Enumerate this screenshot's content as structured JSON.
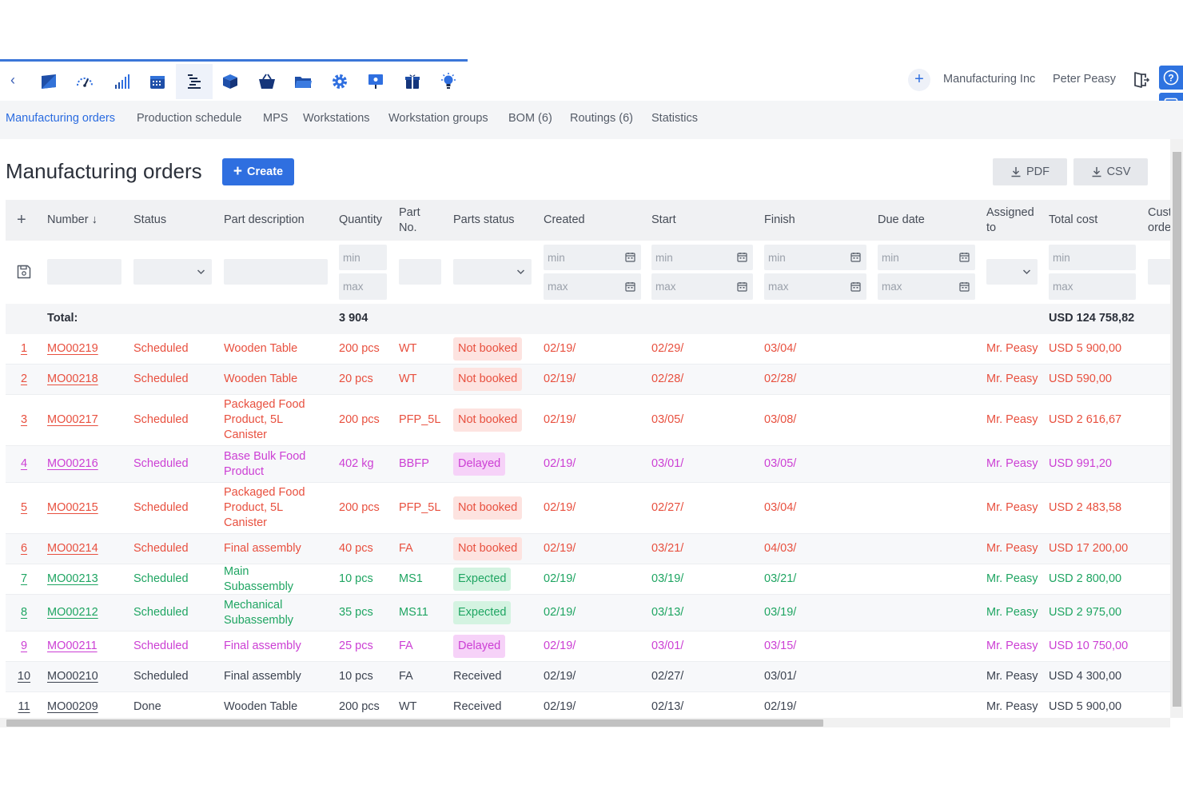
{
  "toolbar": {
    "back_icon": "chevron-left-icon",
    "apps": [
      {
        "name": "sales-icon",
        "active": false
      },
      {
        "name": "dashboard-gauge-icon",
        "active": false
      },
      {
        "name": "bar-signal-icon",
        "active": false
      },
      {
        "name": "calendar-icon",
        "active": false
      },
      {
        "name": "production-list-icon",
        "active": true
      },
      {
        "name": "box-icon",
        "active": false
      },
      {
        "name": "basket-icon",
        "active": false
      },
      {
        "name": "folder-icon",
        "active": false
      },
      {
        "name": "settings-gear-icon",
        "active": false
      },
      {
        "name": "presentation-icon",
        "active": false
      },
      {
        "name": "gift-icon",
        "active": false
      },
      {
        "name": "lightbulb-icon",
        "active": false
      }
    ],
    "company": "Manufacturing Inc",
    "user": "Peter Peasy"
  },
  "tabs": [
    {
      "label": "Manufacturing orders",
      "active": true
    },
    {
      "label": "Production schedule",
      "active": false
    },
    {
      "label": "MPS",
      "active": false
    },
    {
      "label": "Workstations",
      "active": false
    },
    {
      "label": "Workstation groups",
      "active": false
    },
    {
      "label": "BOM (6)",
      "active": false
    },
    {
      "label": "Routings (6)",
      "active": false
    },
    {
      "label": "Statistics",
      "active": false
    }
  ],
  "page": {
    "title": "Manufacturing orders",
    "create_label": "Create",
    "pdf_label": "PDF",
    "csv_label": "CSV"
  },
  "table": {
    "columns": {
      "add": "+",
      "number": "Number ↓",
      "status": "Status",
      "part_description": "Part description",
      "quantity": "Quantity",
      "part_no": "Part No.",
      "parts_status": "Parts status",
      "created": "Created",
      "start": "Start",
      "finish": "Finish",
      "due_date": "Due date",
      "assigned_to": "Assigned to",
      "total_cost": "Total cost",
      "customer_order": "Customer order"
    },
    "filters": {
      "min": "min",
      "max": "max"
    },
    "totals": {
      "label": "Total:",
      "quantity": "3 904",
      "total_cost": "USD 124 758,82"
    },
    "colors": {
      "red": "#e8503f",
      "red_badge_bg": "#fde3e0",
      "magenta": "#cc3fd4",
      "magenta_badge_bg": "#f6d2f8",
      "green": "#1fa562",
      "green_badge_bg": "#d4f3e1",
      "neutral": "#3c4350"
    },
    "rows": [
      {
        "idx": "1",
        "number": "MO00219",
        "status": "Scheduled",
        "part": "Wooden Table",
        "qty": "200 pcs",
        "part_no": "WT",
        "parts_status": "Not booked",
        "created": "02/19/",
        "start": "02/29/",
        "finish": "03/04/",
        "due": "",
        "assigned": "Mr. Peasy",
        "cost": "USD 5 900,00",
        "tone": "red"
      },
      {
        "idx": "2",
        "number": "MO00218",
        "status": "Scheduled",
        "part": "Wooden Table",
        "qty": "20 pcs",
        "part_no": "WT",
        "parts_status": "Not booked",
        "created": "02/19/",
        "start": "02/28/",
        "finish": "02/28/",
        "due": "",
        "assigned": "Mr. Peasy",
        "cost": "USD 590,00",
        "tone": "red"
      },
      {
        "idx": "3",
        "number": "MO00217",
        "status": "Scheduled",
        "part": "Packaged Food Product, 5L Canister",
        "qty": "200 pcs",
        "part_no": "PFP_5L",
        "parts_status": "Not booked",
        "created": "02/19/",
        "start": "03/05/",
        "finish": "03/08/",
        "due": "",
        "assigned": "Mr. Peasy",
        "cost": "USD 2 616,67",
        "tone": "red"
      },
      {
        "idx": "4",
        "number": "MO00216",
        "status": "Scheduled",
        "part": "Base Bulk Food Product",
        "qty": "402 kg",
        "part_no": "BBFP",
        "parts_status": "Delayed",
        "created": "02/19/",
        "start": "03/01/",
        "finish": "03/05/",
        "due": "",
        "assigned": "Mr. Peasy",
        "cost": "USD 991,20",
        "tone": "magenta"
      },
      {
        "idx": "5",
        "number": "MO00215",
        "status": "Scheduled",
        "part": "Packaged Food Product, 5L Canister",
        "qty": "200 pcs",
        "part_no": "PFP_5L",
        "parts_status": "Not booked",
        "created": "02/19/",
        "start": "02/27/",
        "finish": "03/04/",
        "due": "",
        "assigned": "Mr. Peasy",
        "cost": "USD 2 483,58",
        "tone": "red"
      },
      {
        "idx": "6",
        "number": "MO00214",
        "status": "Scheduled",
        "part": "Final assembly",
        "qty": "40 pcs",
        "part_no": "FA",
        "parts_status": "Not booked",
        "created": "02/19/",
        "start": "03/21/",
        "finish": "04/03/",
        "due": "",
        "assigned": "Mr. Peasy",
        "cost": "USD 17 200,00",
        "tone": "red"
      },
      {
        "idx": "7",
        "number": "MO00213",
        "status": "Scheduled",
        "part": "Main Subassembly",
        "qty": "10 pcs",
        "part_no": "MS1",
        "parts_status": "Expected",
        "created": "02/19/",
        "start": "03/19/",
        "finish": "03/21/",
        "due": "",
        "assigned": "Mr. Peasy",
        "cost": "USD 2 800,00",
        "tone": "green"
      },
      {
        "idx": "8",
        "number": "MO00212",
        "status": "Scheduled",
        "part": "Mechanical Subassembly",
        "qty": "35 pcs",
        "part_no": "MS11",
        "parts_status": "Expected",
        "created": "02/19/",
        "start": "03/13/",
        "finish": "03/19/",
        "due": "",
        "assigned": "Mr. Peasy",
        "cost": "USD 2 975,00",
        "tone": "green"
      },
      {
        "idx": "9",
        "number": "MO00211",
        "status": "Scheduled",
        "part": "Final assembly",
        "qty": "25 pcs",
        "part_no": "FA",
        "parts_status": "Delayed",
        "created": "02/19/",
        "start": "03/01/",
        "finish": "03/15/",
        "due": "",
        "assigned": "Mr. Peasy",
        "cost": "USD 10 750,00",
        "tone": "magenta"
      },
      {
        "idx": "10",
        "number": "MO00210",
        "status": "Scheduled",
        "part": "Final assembly",
        "qty": "10 pcs",
        "part_no": "FA",
        "parts_status": "Received",
        "created": "02/19/",
        "start": "02/27/",
        "finish": "03/01/",
        "due": "",
        "assigned": "Mr. Peasy",
        "cost": "USD 4 300,00",
        "tone": "neutral"
      },
      {
        "idx": "11",
        "number": "MO00209",
        "status": "Done",
        "part": "Wooden Table",
        "qty": "200 pcs",
        "part_no": "WT",
        "parts_status": "Received",
        "created": "02/19/",
        "start": "02/13/",
        "finish": "02/19/",
        "due": "",
        "assigned": "Mr. Peasy",
        "cost": "USD 5 900,00",
        "tone": "neutral"
      }
    ]
  }
}
